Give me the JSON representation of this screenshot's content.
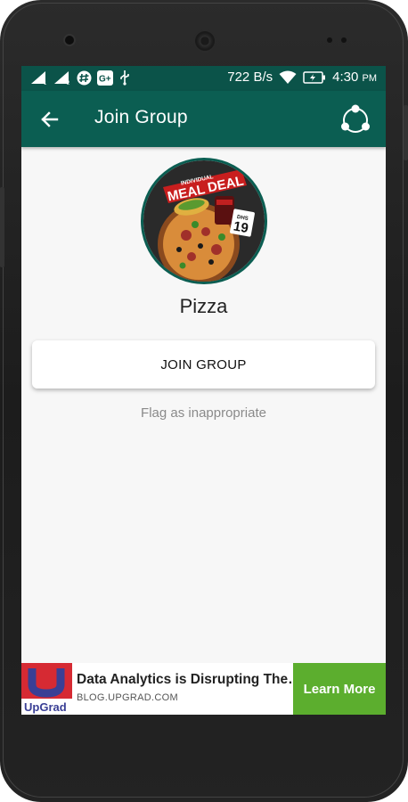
{
  "status_bar": {
    "net_speed": "722 B/s",
    "time": "4:30",
    "ampm": "PM"
  },
  "toolbar": {
    "back_icon": "arrow-left-icon",
    "title": "Join Group",
    "share_icon": "share-icon"
  },
  "group": {
    "avatar_badge_top": "INDIVIDUAL",
    "avatar_badge_meal": "MEAL",
    "avatar_badge_deal": "DEAL",
    "avatar_price_currency": "DHS",
    "avatar_price": "19",
    "name": "Pizza"
  },
  "actions": {
    "join_label": "JOIN GROUP",
    "flag_label": "Flag as inappropriate"
  },
  "ad": {
    "brand": "UpGrad",
    "headline": "Data Analytics is Disrupting The…",
    "url": "BLOG.UPGRAD.COM",
    "cta": "Learn More"
  },
  "colors": {
    "toolbar": "#0b5e52",
    "statusbar": "#0b5349",
    "ad_cta": "#5cae2e"
  }
}
